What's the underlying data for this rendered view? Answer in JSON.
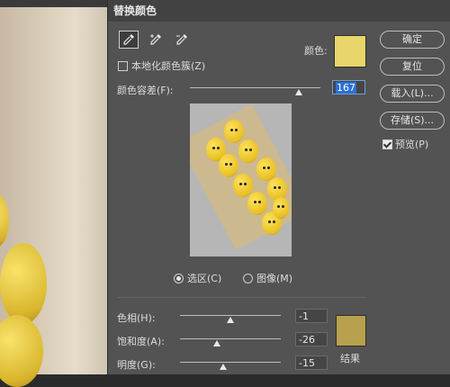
{
  "dialog": {
    "title": "替换颜色",
    "tools": [
      {
        "icon": "eyedropper-icon",
        "active": true
      },
      {
        "icon": "eyedropper-plus-icon",
        "active": false
      },
      {
        "icon": "eyedropper-minus-icon",
        "active": false
      }
    ],
    "localized_color_clusters_label": "本地化颜色簇(Z)",
    "localized_color_clusters_checked": false,
    "color_label": "颜色:",
    "selected_color": "#e8d66a",
    "fuzziness_label": "颜色容差(F):",
    "fuzziness_value": "167",
    "fuzziness_max": 200,
    "view_options": {
      "selection_label": "选区(C)",
      "image_label": "图像(M)",
      "selected": "selection"
    },
    "hue_label": "色相(H):",
    "hue_value": "-1",
    "saturation_label": "饱和度(A):",
    "saturation_value": "-26",
    "lightness_label": "明度(G):",
    "lightness_value": "-15",
    "result_label": "结果",
    "result_color": "#b8a14e"
  },
  "buttons": {
    "ok": "确定",
    "reset": "复位",
    "load": "载入(L)...",
    "save": "存储(S)...",
    "preview_label": "预览(P)",
    "preview_checked": true
  }
}
